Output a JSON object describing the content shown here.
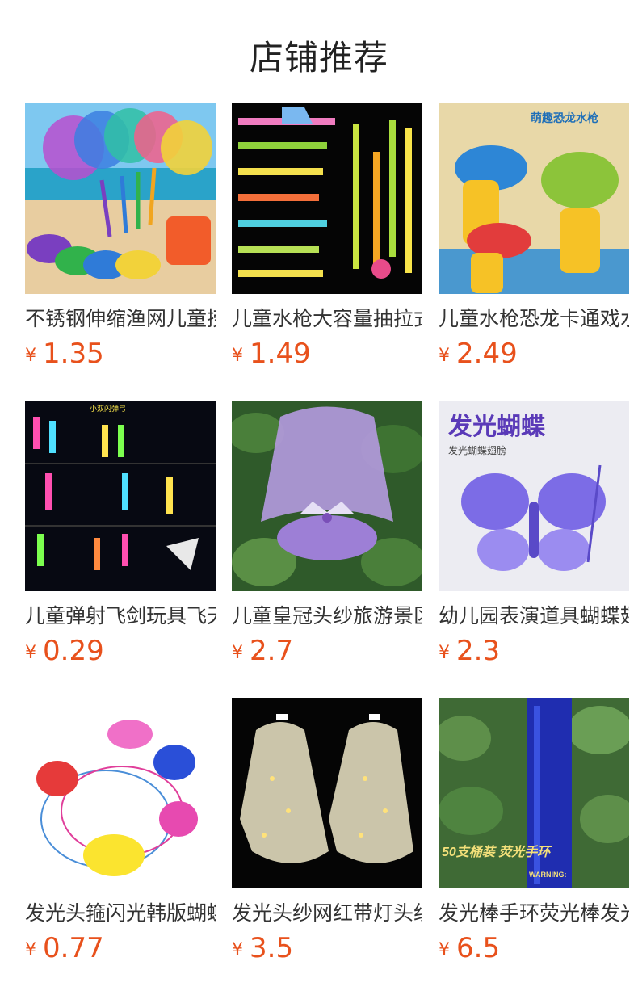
{
  "header": {
    "title": "店铺推荐"
  },
  "products": [
    {
      "title": "不锈钢伸缩渔网儿童捞鱼网",
      "currency": "¥",
      "price": "1.35",
      "thumb": "beach-nets"
    },
    {
      "title": "儿童水枪大容量抽拉式",
      "currency": "¥",
      "price": "1.49",
      "thumb": "water-guns"
    },
    {
      "title": "儿童水枪恐龙卡通戏水",
      "currency": "¥",
      "price": "2.49",
      "thumb": "dino-guns",
      "thumb_text": "萌趣恐龙水枪"
    },
    {
      "title": "儿童弹射飞剑玩具飞天",
      "currency": "¥",
      "price": "0.29",
      "thumb": "glow-arrows",
      "thumb_text": "小双闪弹弓"
    },
    {
      "title": "儿童皇冠头纱旅游景区",
      "currency": "¥",
      "price": "2.7",
      "thumb": "crown-veil"
    },
    {
      "title": "幼儿园表演道具蝴蝶翅膀",
      "currency": "¥",
      "price": "2.3",
      "thumb": "butterfly",
      "thumb_text": "发光蝴蝶",
      "thumb_subtext": "发光蝴蝶翅膀"
    },
    {
      "title": "发光头箍闪光韩版蝴蝶结",
      "currency": "¥",
      "price": "0.77",
      "thumb": "bow-headbands"
    },
    {
      "title": "发光头纱网红带灯头纱",
      "currency": "¥",
      "price": "3.5",
      "thumb": "led-veils"
    },
    {
      "title": "发光棒手环荧光棒发光",
      "currency": "¥",
      "price": "6.5",
      "thumb": "glow-sticks",
      "thumb_text": "50支桶装 荧光手环",
      "thumb_subtext": "WARNING:"
    }
  ]
}
